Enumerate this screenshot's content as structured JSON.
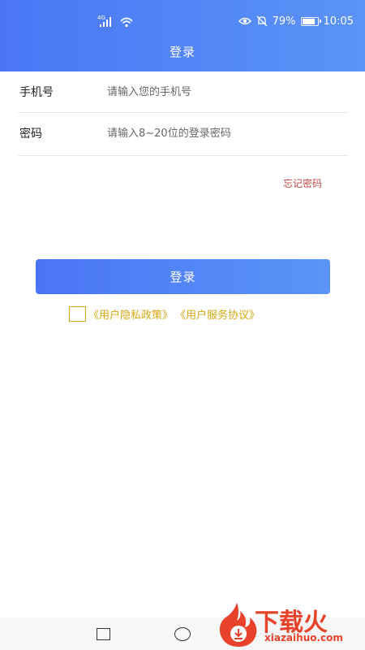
{
  "status_bar": {
    "battery_text": "79%",
    "time": "10:05",
    "network_label": "4G",
    "icons": [
      "signal-icon",
      "wifi-icon",
      "eye-icon",
      "mute-icon",
      "battery-icon"
    ]
  },
  "header": {
    "title": "登录"
  },
  "form": {
    "phone": {
      "label": "手机号",
      "placeholder": "请输入您的手机号",
      "value": ""
    },
    "password": {
      "label": "密码",
      "placeholder": "请输入8~20位的登录密码",
      "value": ""
    },
    "forgot_label": "忘记密码"
  },
  "login_button": {
    "label": "登录"
  },
  "agreement": {
    "checked": false,
    "privacy_link": "《用户隐私政策》",
    "service_link": "《用户服务协议》"
  },
  "nav": {
    "icons": [
      "recent-apps-icon",
      "home-icon"
    ]
  },
  "watermark": {
    "text": "下载火",
    "url": "xiazaihuo.com"
  },
  "colors": {
    "header_start": "#4a76f5",
    "header_end": "#5a94f7",
    "forgot": "#c44848",
    "agreement": "#d6a814",
    "watermark": "#e8422a"
  }
}
